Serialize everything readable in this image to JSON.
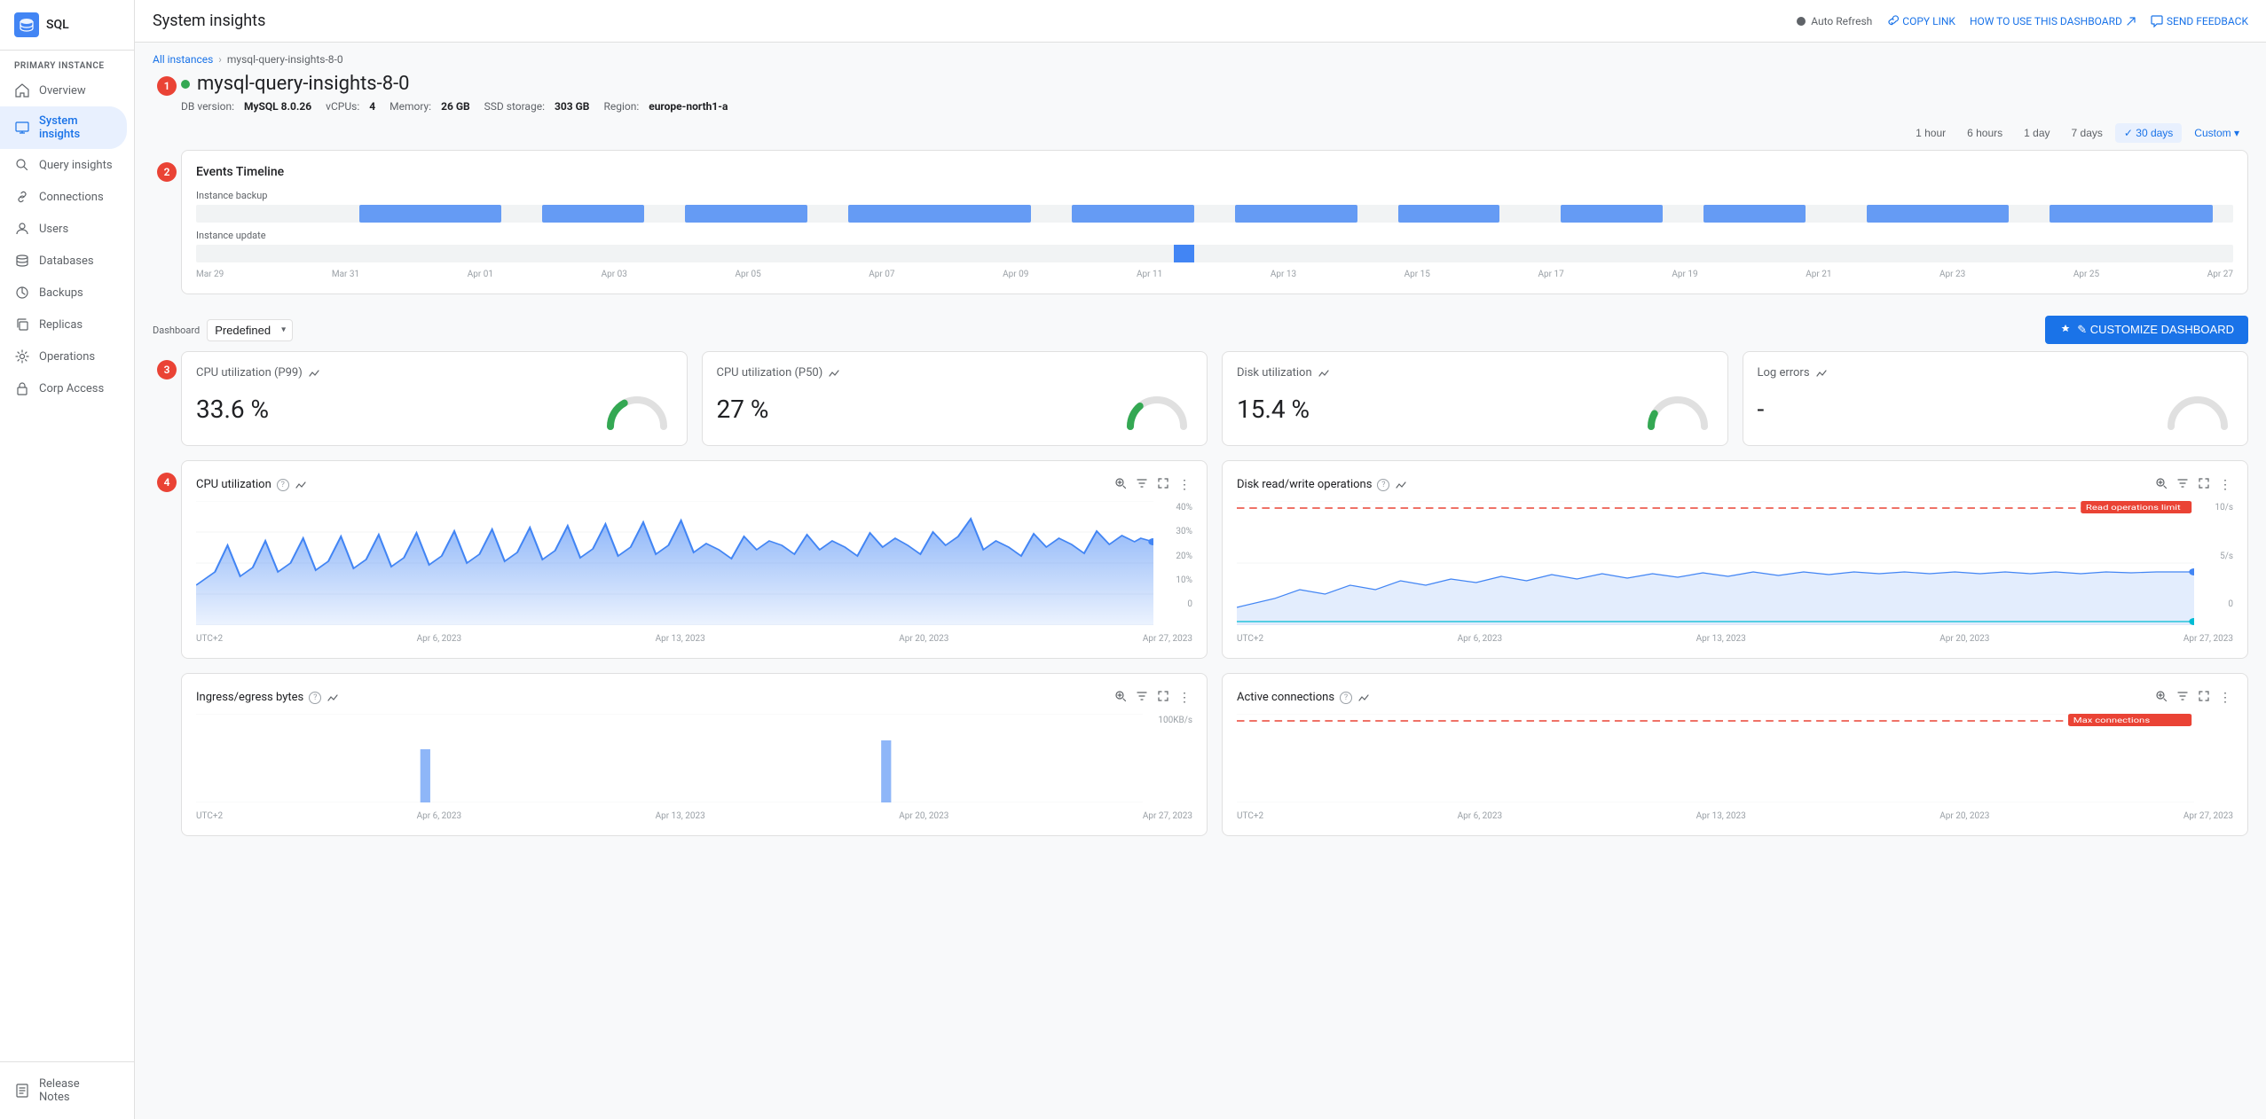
{
  "app": {
    "logo": "SQL",
    "title": "System insights"
  },
  "topbar": {
    "title": "System insights",
    "auto_refresh_label": "Auto Refresh",
    "copy_link_label": "COPY LINK",
    "how_to_label": "HOW TO USE THIS DASHBOARD",
    "feedback_label": "SEND FEEDBACK"
  },
  "sidebar": {
    "section_label": "PRIMARY INSTANCE",
    "items": [
      {
        "id": "overview",
        "label": "Overview",
        "icon": "home"
      },
      {
        "id": "system-insights",
        "label": "System insights",
        "icon": "monitor",
        "active": true
      },
      {
        "id": "query-insights",
        "label": "Query insights",
        "icon": "search"
      },
      {
        "id": "connections",
        "label": "Connections",
        "icon": "link"
      },
      {
        "id": "users",
        "label": "Users",
        "icon": "person"
      },
      {
        "id": "databases",
        "label": "Databases",
        "icon": "database"
      },
      {
        "id": "backups",
        "label": "Backups",
        "icon": "backup"
      },
      {
        "id": "replicas",
        "label": "Replicas",
        "icon": "copy"
      },
      {
        "id": "operations",
        "label": "Operations",
        "icon": "settings"
      },
      {
        "id": "corp-access",
        "label": "Corp Access",
        "icon": "lock"
      }
    ],
    "bottom_item": "Release Notes"
  },
  "breadcrumb": {
    "parent": "All instances",
    "current": "mysql-query-insights-8-0"
  },
  "instance": {
    "name": "mysql-query-insights-8-0",
    "db_version_label": "DB version:",
    "db_version": "MySQL 8.0.26",
    "vcpus_label": "vCPUs:",
    "vcpus": "4",
    "memory_label": "Memory:",
    "memory": "26 GB",
    "storage_label": "SSD storage:",
    "storage": "303 GB",
    "region_label": "Region:",
    "region": "europe-north1-a"
  },
  "time_range": {
    "options": [
      "1 hour",
      "6 hours",
      "1 day",
      "7 days",
      "30 days",
      "Custom"
    ],
    "active": "30 days"
  },
  "events_timeline": {
    "title": "Events Timeline",
    "rows": [
      {
        "label": "Instance backup"
      },
      {
        "label": "Instance update"
      }
    ],
    "axis": [
      "Mar 29",
      "Mar 31",
      "Apr 01",
      "Apr 03",
      "Apr 05",
      "Apr 07",
      "Apr 09",
      "Apr 11",
      "Apr 13",
      "Apr 15",
      "Apr 17",
      "Apr 19",
      "Apr 21",
      "Apr 23",
      "Apr 25",
      "Apr 27"
    ]
  },
  "dashboard": {
    "label": "Dashboard",
    "select_label": "Predefined",
    "customize_label": "✎ CUSTOMIZE DASHBOARD"
  },
  "metric_cards": [
    {
      "id": "cpu-p99",
      "title": "CPU utilization (P99)",
      "value": "33.6 %",
      "gauge_pct": 33.6,
      "gauge_color": "#34a853"
    },
    {
      "id": "cpu-p50",
      "title": "CPU utilization (P50)",
      "value": "27 %",
      "gauge_pct": 27,
      "gauge_color": "#34a853"
    },
    {
      "id": "disk",
      "title": "Disk utilization",
      "value": "15.4 %",
      "gauge_pct": 15.4,
      "gauge_color": "#34a853"
    },
    {
      "id": "log-errors",
      "title": "Log errors",
      "value": "-",
      "gauge_pct": 0,
      "gauge_color": "#e0e0e0"
    }
  ],
  "charts_row1": [
    {
      "id": "cpu-utilization",
      "title": "CPU utilization",
      "has_info": true,
      "y_labels": [
        "40%",
        "30%",
        "20%",
        "10%",
        "0"
      ],
      "x_labels": [
        "UTC+2",
        "Apr 6, 2023",
        "Apr 13, 2023",
        "Apr 20, 2023",
        "Apr 27, 2023"
      ]
    },
    {
      "id": "disk-rw",
      "title": "Disk read/write operations",
      "has_info": true,
      "y_labels": [
        "10/s",
        "5/s",
        "0"
      ],
      "x_labels": [
        "UTC+2",
        "Apr 6, 2023",
        "Apr 13, 2023",
        "Apr 20, 2023",
        "Apr 27, 2023"
      ],
      "has_limit_line": true,
      "limit_label": "Read operations limit"
    }
  ],
  "charts_row2": [
    {
      "id": "ingress-egress",
      "title": "Ingress/egress bytes",
      "has_info": true,
      "y_labels": [
        "100KB/s",
        ""
      ],
      "x_labels": [
        "UTC+2",
        "Apr 6, 2023",
        "Apr 13, 2023",
        "Apr 20, 2023",
        "Apr 27, 2023"
      ]
    },
    {
      "id": "active-connections",
      "title": "Active connections",
      "has_info": true,
      "y_labels": [
        "",
        ""
      ],
      "x_labels": [
        "UTC+2",
        "Apr 6, 2023",
        "Apr 13, 2023",
        "Apr 20, 2023",
        "Apr 27, 2023"
      ],
      "has_limit_line": true,
      "limit_label": "Max connections"
    }
  ]
}
